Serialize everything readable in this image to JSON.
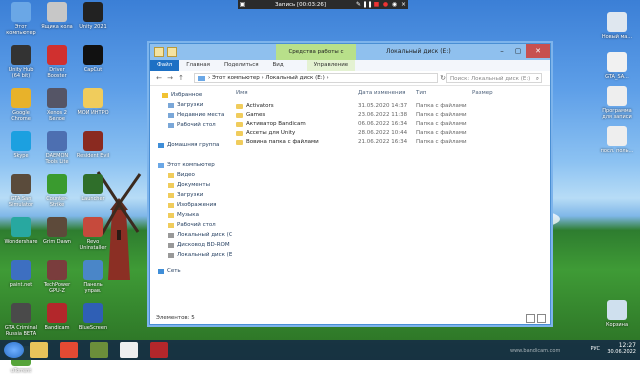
{
  "recording": {
    "title": "Запись [00:03:26]"
  },
  "desktop": {
    "left_icons": [
      {
        "label": "Этот компьютер",
        "color": "#6aa7e6"
      },
      {
        "label": "Ящика кола",
        "color": "#c7c7c7"
      },
      {
        "label": "Unity 2021",
        "color": "#222"
      },
      {
        "label": "Unity Hub (64 bit)",
        "color": "#333"
      },
      {
        "label": "Driver Booster",
        "color": "#d0302f"
      },
      {
        "label": "CapCut",
        "color": "#111"
      },
      {
        "label": "Google Chrome",
        "color": "#e8b22a"
      },
      {
        "label": "Xenos 2 Белое",
        "color": "#556"
      },
      {
        "label": "МОИ ИНТРО",
        "color": "#f0cc5c"
      },
      {
        "label": "Skype",
        "color": "#1ca0e0"
      },
      {
        "label": "DAEMON Tools Lite",
        "color": "#4d6fb1"
      },
      {
        "label": "Resident Evil",
        "color": "#8a2a20"
      },
      {
        "label": "GTA San Simulator",
        "color": "#5a4b3b"
      },
      {
        "label": "Counter-Strike",
        "color": "#3a9b2f"
      },
      {
        "label": "Launcher",
        "color": "#2f6e2a"
      },
      {
        "label": "Wondershare",
        "color": "#28a8a0"
      },
      {
        "label": "Grim Dawn",
        "color": "#5d4a3a"
      },
      {
        "label": "Revo Uninstaller",
        "color": "#c64a3c"
      },
      {
        "label": "paint.net",
        "color": "#3d6fc1"
      },
      {
        "label": "TechPower GPU-Z",
        "color": "#7a3d3d"
      },
      {
        "label": "Панель управ.",
        "color": "#4a86c8"
      },
      {
        "label": "GTA Criminal Russia BETA",
        "color": "#4a4a4a"
      },
      {
        "label": "Bandicam",
        "color": "#b3272b"
      },
      {
        "label": "BlueScreen",
        "color": "#2f5fb5"
      },
      {
        "label": "uTorrent",
        "color": "#56a43a"
      }
    ],
    "right_icons": [
      {
        "label": "Новый ма...",
        "color": "#dfe7ef"
      },
      {
        "label": "GTA_SA...",
        "color": "#f1f1f1"
      },
      {
        "label": "Программа для записи",
        "color": "#eee"
      },
      {
        "label": "посл. поль...",
        "color": "#eee"
      },
      {
        "label": "Корзина",
        "color": "#cfe0ee"
      }
    ]
  },
  "window": {
    "title": "Локальный диск (E:)",
    "context_group": "Средства работы с дисками",
    "ribbon_tabs": [
      "Файл",
      "Главная",
      "Поделиться",
      "Вид",
      "Управление"
    ],
    "address": {
      "segments": [
        "Этот компьютер",
        "Локальный диск (E:)"
      ],
      "separator": "›"
    },
    "search_placeholder": "Поиск: Локальный диск (E:)",
    "nav": {
      "favorites_header": "Избранное",
      "favorites": [
        "Загрузки",
        "Недавние места",
        "Рабочий стол"
      ],
      "homegroup": "Домашняя группа",
      "computer_header": "Этот компьютер",
      "computer_items": [
        "Видео",
        "Документы",
        "Загрузки",
        "Изображения",
        "Музыка",
        "Рабочий стол",
        "Локальный диск (C:)",
        "Дисковод BD-ROM",
        "Локальный диск (E:)"
      ],
      "network": "Сеть"
    },
    "columns": [
      "Имя",
      "Дата изменения",
      "Тип",
      "Размер"
    ],
    "files": [
      {
        "name": "Activators",
        "date": "31.05.2020 14:37",
        "type": "Папка с файлами",
        "size": ""
      },
      {
        "name": "Games",
        "date": "23.06.2022 11:38",
        "type": "Папка с файлами",
        "size": ""
      },
      {
        "name": "Активатор Bandicam",
        "date": "06.06.2022 16:34",
        "type": "Папка с файлами",
        "size": ""
      },
      {
        "name": "Ассеты для Unity",
        "date": "28.06.2022 10:44",
        "type": "Папка с файлами",
        "size": ""
      },
      {
        "name": "Вовина папка с файлами",
        "date": "21.06.2022 16:34",
        "type": "Папка с файлами",
        "size": ""
      }
    ],
    "status": "Элементов: 5"
  },
  "taskbar": {
    "time": "12:27",
    "date": "30.06.2022",
    "lang": "РУС",
    "items": [
      {
        "name": "file-explorer",
        "color": "#e8c35a"
      },
      {
        "name": "chrome",
        "color": "#e34a33"
      },
      {
        "name": "minecraft",
        "color": "#6b8e3a"
      },
      {
        "name": "unity",
        "color": "#eee"
      },
      {
        "name": "bandicam",
        "color": "#b3272b"
      }
    ]
  },
  "watermark": "www.bandicam.com"
}
